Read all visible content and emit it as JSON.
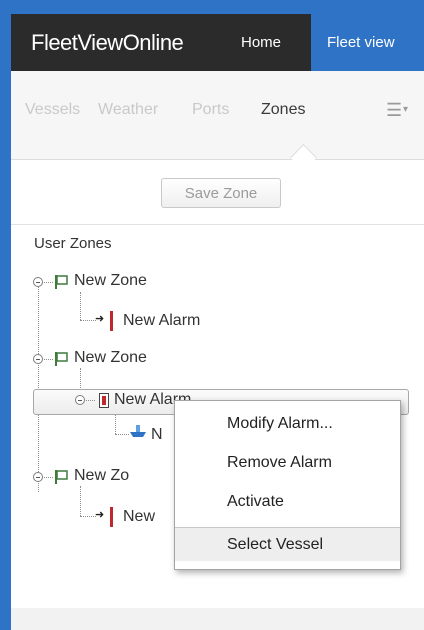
{
  "app": {
    "brand": "FleetViewOnline",
    "nav": {
      "home": "Home",
      "fleet_view": "Fleet view"
    }
  },
  "tabs": [
    {
      "label": "Vessels",
      "active": false
    },
    {
      "label": "Weather",
      "active": false
    },
    {
      "label": "Ports",
      "active": false
    },
    {
      "label": "Zones",
      "active": true
    }
  ],
  "menu_icon": "hamburger-menu-icon",
  "toolbar": {
    "save_label": "Save Zone"
  },
  "tree": {
    "title": "User Zones",
    "nodes": [
      {
        "label": "New Zone",
        "children": [
          {
            "label": "New Alarm"
          }
        ]
      },
      {
        "label": "New Zone",
        "children": [
          {
            "label": "New Alarm",
            "selected": true,
            "children": [
              {
                "label": "N"
              }
            ]
          }
        ]
      },
      {
        "label": "New Zo",
        "children": [
          {
            "label": "New"
          }
        ]
      }
    ]
  },
  "context_menu": {
    "items": [
      {
        "label": "Modify Alarm..."
      },
      {
        "label": "Remove Alarm"
      },
      {
        "label": "Activate"
      },
      {
        "label": "Select Vessel",
        "highlighted": true
      }
    ]
  },
  "colors": {
    "accent": "#2f73c7",
    "topbar": "#2b2b2b",
    "alarm_red": "#c0282f",
    "flag_green": "#3f7a3a"
  }
}
